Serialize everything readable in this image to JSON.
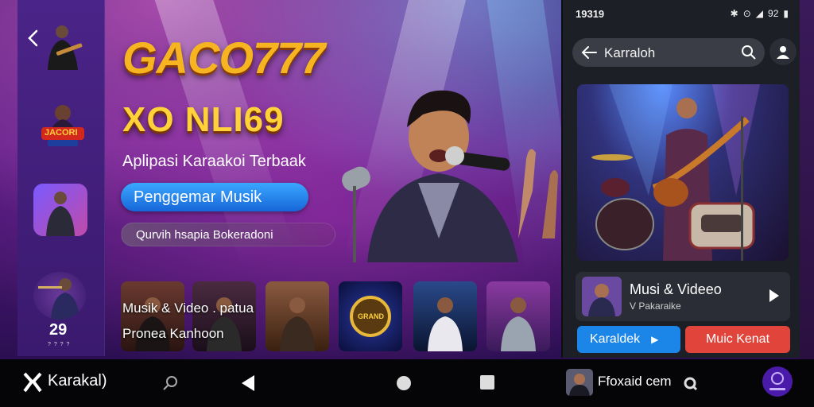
{
  "hero": {
    "logo_main": "GACO777",
    "logo_sub": "XO NLI69",
    "tagline": "Aplipasi Karaakoi Terbaak",
    "primary_button": "Penggemar Musik",
    "search_pill": "Qurvih hsapia Bokeradoni"
  },
  "sidebar": {
    "badge_text": "JACORI",
    "count": "29",
    "count_sub": "? ? ? ?"
  },
  "thumb_row": {
    "caption_1": "Musik & Video . patua",
    "caption_2": "Pronea Kanhoon",
    "medallion_text": "GRAND"
  },
  "phone": {
    "status_time": "19319",
    "status_right": "92",
    "search_text": "Karraloh",
    "now_playing": {
      "title": "Musi & Videeo",
      "subtitle": "V Pakaraike"
    },
    "button_karaoke": "Karaldek",
    "button_music": "Muic Kenat"
  },
  "navbar": {
    "brand": "Karakal)",
    "account": "Ffoxaid cem"
  },
  "colors": {
    "accent_blue": "#1b86e8",
    "accent_red": "#e0443b",
    "logo_gold": "#f7b421",
    "sidebar_purple": "#4a2488"
  }
}
